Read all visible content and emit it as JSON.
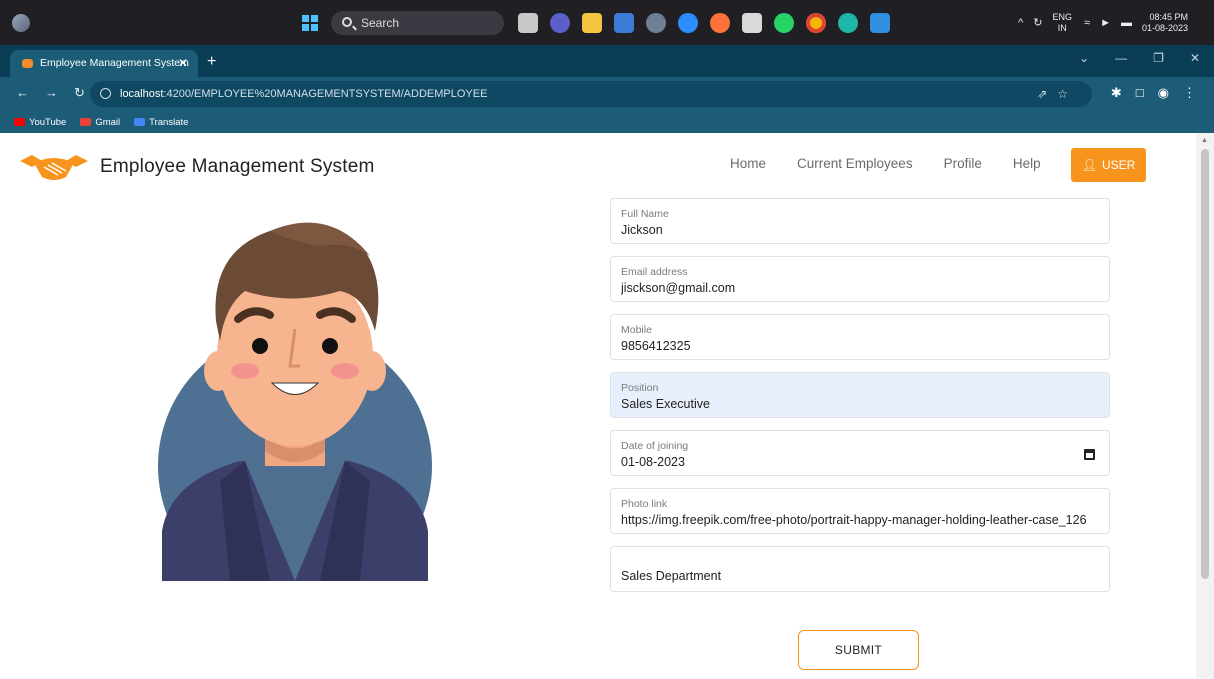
{
  "taskbar": {
    "search_label": "Search",
    "language_top": "ENG",
    "language_bottom": "IN",
    "time": "08:45 PM",
    "date": "01-08-2023"
  },
  "browser": {
    "tab_title": "Employee Management System",
    "url_host": "localhost",
    "url_path": ":4200/EMPLOYEE%20MANAGEMENTSYSTEM/ADDEMPLOYEE",
    "bookmarks": [
      {
        "label": "YouTube",
        "color": "#ff0000"
      },
      {
        "label": "Gmail",
        "color": "#ea4335"
      },
      {
        "label": "Translate",
        "color": "#4285f4"
      }
    ]
  },
  "site": {
    "title": "Employee Management System",
    "nav": {
      "home": "Home",
      "current_employees": "Current Employees",
      "profile": "Profile",
      "help": "Help",
      "user": "USER"
    },
    "accent_color": "#f7941d"
  },
  "form": {
    "full_name": {
      "label": "Full Name",
      "value": "Jickson"
    },
    "email": {
      "label": "Email address",
      "value": "jisckson@gmail.com"
    },
    "mobile": {
      "label": "Mobile",
      "value": "9856412325"
    },
    "position": {
      "label": "Position",
      "value": "Sales Executive"
    },
    "date_of_joining": {
      "label": "Date of joining",
      "value": "01-08-2023"
    },
    "photo_link": {
      "label": "Photo link",
      "value": "https://img.freepik.com/free-photo/portrait-happy-manager-holding-leather-case_126"
    },
    "department": {
      "value": "Sales Department"
    },
    "submit_label": "SUBMIT"
  }
}
